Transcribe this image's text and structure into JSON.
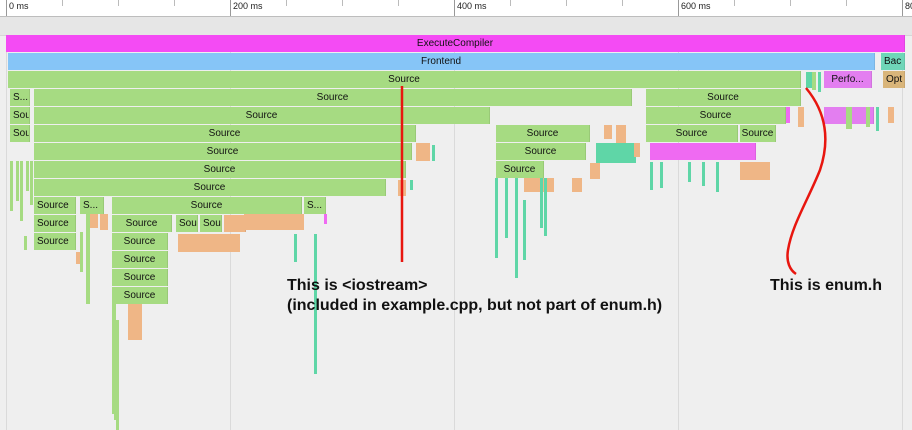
{
  "ruler": {
    "ticks": [
      "0 ms",
      "200 ms",
      "400 ms",
      "600 ms",
      "80"
    ]
  },
  "flame": {
    "colors": {
      "compiler": "#f44bf4",
      "frontend": "#86c5f7",
      "source": "#a6db82",
      "backend": "#6fd6b8",
      "optimizer": "#d9b57a",
      "perf": "#e37ef0",
      "teal": "#5fd6a7",
      "orange": "#efb686",
      "pink": "#ef6af2"
    },
    "labels": {
      "execute_compiler": "ExecuteCompiler",
      "frontend": "Frontend",
      "backend": "Bac",
      "source": "Source",
      "perf": "Perfo...",
      "opt": "Opt",
      "source_short_s": "S...",
      "source_short_sou": "Sou"
    }
  },
  "annotations": {
    "iostream_line1": "This is <iostream>",
    "iostream_line2": "(included in example.cpp, but not part of enum.h)",
    "enum_label": "This is enum.h",
    "line_color": "#e8160f"
  }
}
